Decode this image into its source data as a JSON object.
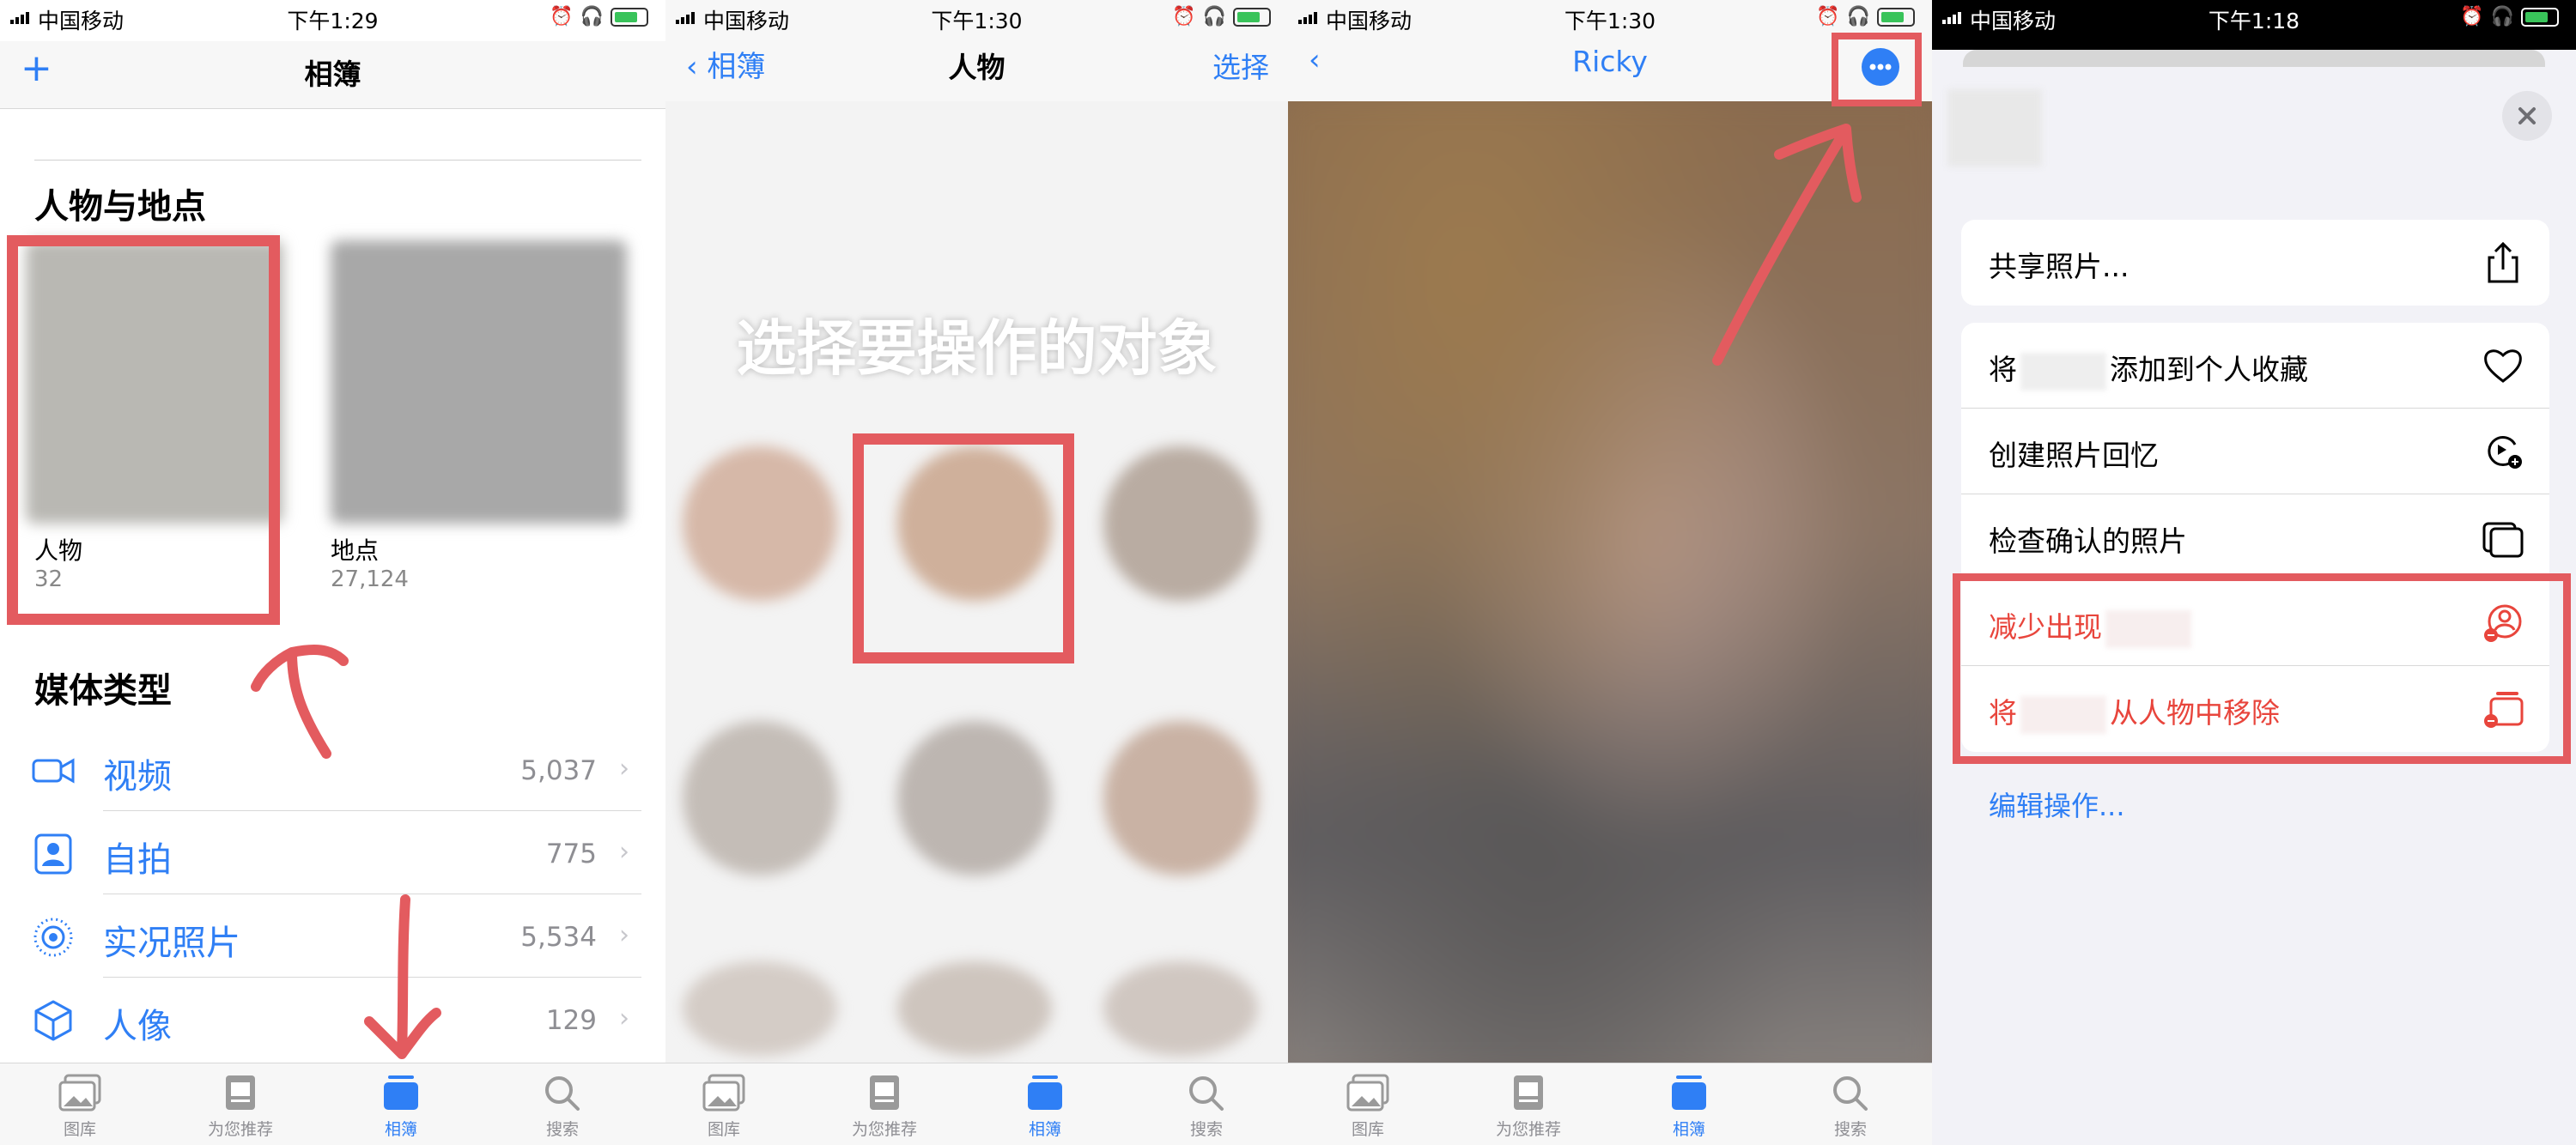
{
  "status": {
    "carrier": "中国移动",
    "times": [
      "下午1:29",
      "下午1:30",
      "下午1:30",
      "下午1:18"
    ]
  },
  "panel1": {
    "title": "相簿",
    "add_icon": "plus-icon",
    "people_section": "人物与地点",
    "people_label": "人物",
    "people_count": "32",
    "places_label": "地点",
    "places_count": "27,124",
    "media_section": "媒体类型",
    "media": [
      {
        "label": "视频",
        "count": "5,037",
        "icon": "video-icon"
      },
      {
        "label": "自拍",
        "count": "775",
        "icon": "selfie-icon"
      },
      {
        "label": "实况照片",
        "count": "5,534",
        "icon": "live-photo-icon"
      },
      {
        "label": "人像",
        "count": "129",
        "icon": "cube-icon"
      }
    ]
  },
  "panel2": {
    "back": "相簿",
    "title": "人物",
    "select": "选择",
    "overlay_text": "选择要操作的对象"
  },
  "panel3": {
    "title": "Ricky"
  },
  "panel4": {
    "menu_group1": [
      {
        "label": "共享照片...",
        "icon": "share-icon"
      }
    ],
    "menu_group2": [
      {
        "prefix": "将",
        "suffix": "添加到个人收藏",
        "icon": "heart-icon",
        "red": false
      },
      {
        "prefix": "创建照片回忆",
        "suffix": "",
        "icon": "memory-add-icon",
        "red": false
      },
      {
        "prefix": "检查确认的照片",
        "suffix": "",
        "icon": "stacked-photos-icon",
        "red": false
      },
      {
        "prefix": "减少出现",
        "suffix": "",
        "icon": "person-minus-icon",
        "red": true
      },
      {
        "prefix": "将",
        "suffix": "从人物中移除",
        "icon": "remove-from-people-icon",
        "red": true
      }
    ],
    "edit_actions": "编辑操作..."
  },
  "tabbar": {
    "items": [
      "图库",
      "为您推荐",
      "相簿",
      "搜索"
    ],
    "active_index": 2
  },
  "colors": {
    "accent": "#2f7ff5",
    "annotation": "#e35b5f",
    "destructive": "#e8453c"
  }
}
